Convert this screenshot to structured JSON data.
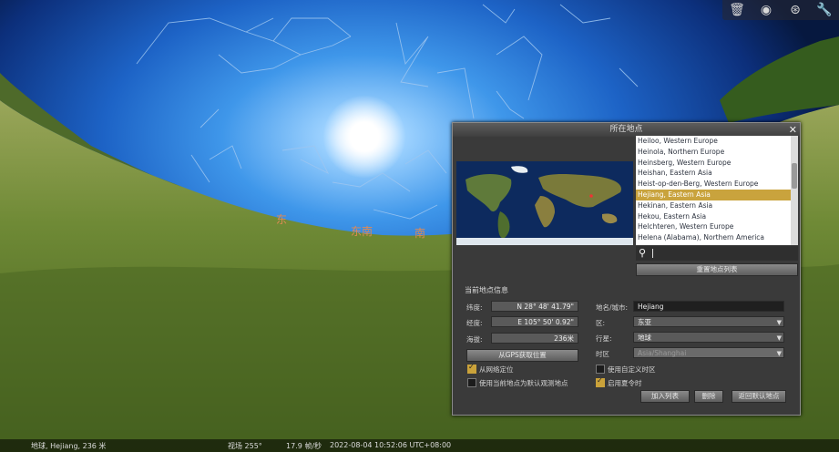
{
  "toolbar": {
    "items": [
      "trash-icon",
      "stop-icon",
      "target-icon",
      "wrench-icon"
    ],
    "glyphs": [
      "🗑",
      "◉",
      "⊛",
      "🔧"
    ]
  },
  "cardinals": {
    "east": "东",
    "se": "东南",
    "south": "南"
  },
  "dialog": {
    "title": "所在地点",
    "close": "✕",
    "list": [
      "Heiloo, Western Europe",
      "Heinola, Northern Europe",
      "Heinsberg, Western Europe",
      "Heishan, Eastern Asia",
      "Heist-op-den-Berg, Western Europe",
      "Hejiang, Eastern Asia",
      "Hekinan, Eastern Asia",
      "Hekou, Eastern Asia",
      "Helchteren, Western Europe",
      "Helena (Alabama), Northern America"
    ],
    "selected_index": 5,
    "reset_list": "重置地点列表",
    "section_title": "当前地点信息",
    "latitude_label": "纬度:",
    "latitude_value": "N 28° 48' 41.79\"",
    "longitude_label": "经度:",
    "longitude_value": "E 105° 50' 0.92\"",
    "altitude_label": "海拔:",
    "altitude_value": "236米",
    "gps_button": "从GPS获取位置",
    "name_label": "地名/城市:",
    "name_value": "Hejiang",
    "region_label": "区:",
    "region_value": "东亚",
    "planet_label": "行星:",
    "planet_value": "地球",
    "timezone_label": "时区",
    "timezone_value": "Asia/Shanghai",
    "cb_network": "从网络定位",
    "cb_network_on": true,
    "cb_default": "使用当前地点为默认观测地点",
    "cb_default_on": false,
    "cb_custom_tz": "使用自定义时区",
    "cb_custom_tz_on": false,
    "cb_dst": "启用夏令时",
    "cb_dst_on": true,
    "add_button": "加入列表",
    "delete_button": "删除",
    "return_button": "返回默认地点"
  },
  "status": {
    "location": "地球, Hejiang, 236 米",
    "fov": "视场 255°",
    "fps": "17.9 帧/秒",
    "datetime": "2022-08-04 10:52:06 UTC+08:00"
  }
}
